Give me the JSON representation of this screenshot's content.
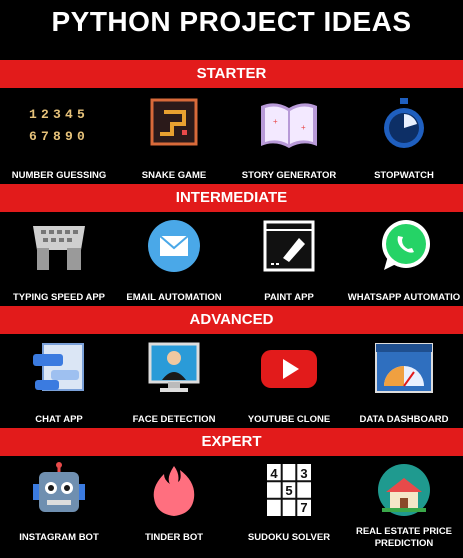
{
  "title": "PYTHON PROJECT IDEAS",
  "sections": [
    {
      "name": "STARTER",
      "items": [
        {
          "label": "NUMBER GUESSING",
          "icon": "number-grid-icon"
        },
        {
          "label": "SNAKE GAME",
          "icon": "snake-game-icon"
        },
        {
          "label": "STORY GENERATOR",
          "icon": "open-book-icon"
        },
        {
          "label": "STOPWATCH",
          "icon": "stopwatch-icon"
        }
      ]
    },
    {
      "name": "INTERMEDIATE",
      "items": [
        {
          "label": "TYPING SPEED APP",
          "icon": "keyboard-hands-icon"
        },
        {
          "label": "EMAIL AUTOMATION",
          "icon": "envelope-icon"
        },
        {
          "label": "PAINT APP",
          "icon": "paint-window-icon"
        },
        {
          "label": "WHATSAPP AUTOMATIO",
          "icon": "whatsapp-icon"
        }
      ]
    },
    {
      "name": "ADVANCED",
      "items": [
        {
          "label": "CHAT APP",
          "icon": "chat-window-icon"
        },
        {
          "label": "FACE DETECTION",
          "icon": "face-scan-icon"
        },
        {
          "label": "YOUTUBE CLONE",
          "icon": "youtube-play-icon"
        },
        {
          "label": "DATA DASHBOARD",
          "icon": "dashboard-gauge-icon"
        }
      ]
    },
    {
      "name": "EXPERT",
      "items": [
        {
          "label": "INSTAGRAM BOT",
          "icon": "robot-icon"
        },
        {
          "label": "TINDER BOT",
          "icon": "flame-icon"
        },
        {
          "label": "SUDOKU SOLVER",
          "icon": "sudoku-grid-icon"
        },
        {
          "label": "REAL ESTATE PRICE PREDICTION",
          "icon": "house-icon"
        }
      ]
    }
  ],
  "sudoku_digits": [
    "4",
    "3",
    "5",
    "7"
  ],
  "number_digits": [
    "1",
    "2",
    "3",
    "4",
    "5",
    "6",
    "7",
    "8",
    "9",
    "0"
  ],
  "colors": {
    "band": "#e21b1b",
    "background": "#000000",
    "text": "#ffffff"
  }
}
